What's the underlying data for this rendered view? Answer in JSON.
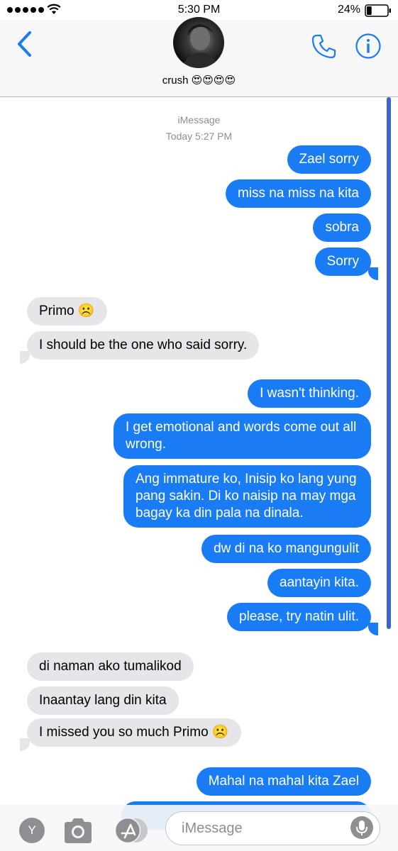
{
  "status_bar": {
    "time": "5:30 PM",
    "battery_percent": "24%",
    "battery_level": 0.24,
    "signal_bars": 5
  },
  "header": {
    "contact_name": "crush 😍😍😍😍",
    "back_icon": "chevron-left-icon",
    "phone_icon": "phone-icon",
    "info_icon": "info-icon"
  },
  "conversation": {
    "service_label": "iMessage",
    "timestamp": "Today 5:27 PM",
    "messages": [
      {
        "from": "me",
        "text": "Zael sorry"
      },
      {
        "from": "me",
        "text": "miss na miss na kita"
      },
      {
        "from": "me",
        "text": "sobra"
      },
      {
        "from": "me",
        "text": "Sorry"
      },
      {
        "from": "them",
        "text": "Primo ☹️"
      },
      {
        "from": "them",
        "text": "I should be the one who said sorry."
      },
      {
        "from": "me",
        "text": "I wasn't thinking."
      },
      {
        "from": "me",
        "text": "I get emotional and words come out all wrong."
      },
      {
        "from": "me",
        "text": "Ang immature ko, Inisip ko lang yung pang sakin. Di ko naisip na may mga bagay ka din pala na dinala."
      },
      {
        "from": "me",
        "text": "dw di na ko mangungulit"
      },
      {
        "from": "me",
        "text": "aantayin kita."
      },
      {
        "from": "me",
        "text": "please, try natin ulit."
      },
      {
        "from": "them",
        "text": "di naman ako tumalikod"
      },
      {
        "from": "them",
        "text": "Inaantay lang din kita"
      },
      {
        "from": "them",
        "text": "I missed you so much Primo ☹️"
      },
      {
        "from": "me",
        "text": "Mahal na mahal kita Zael"
      }
    ]
  },
  "input_bar": {
    "app_button_label": "Y",
    "placeholder": "iMessage",
    "camera_icon": "camera-icon",
    "appstore_icon": "appstore-icon",
    "mic_icon": "microphone-icon"
  },
  "colors": {
    "sent_bubble": "#1a7cf5",
    "received_bubble": "#e5e5ea",
    "accent": "#1a7cf5"
  }
}
